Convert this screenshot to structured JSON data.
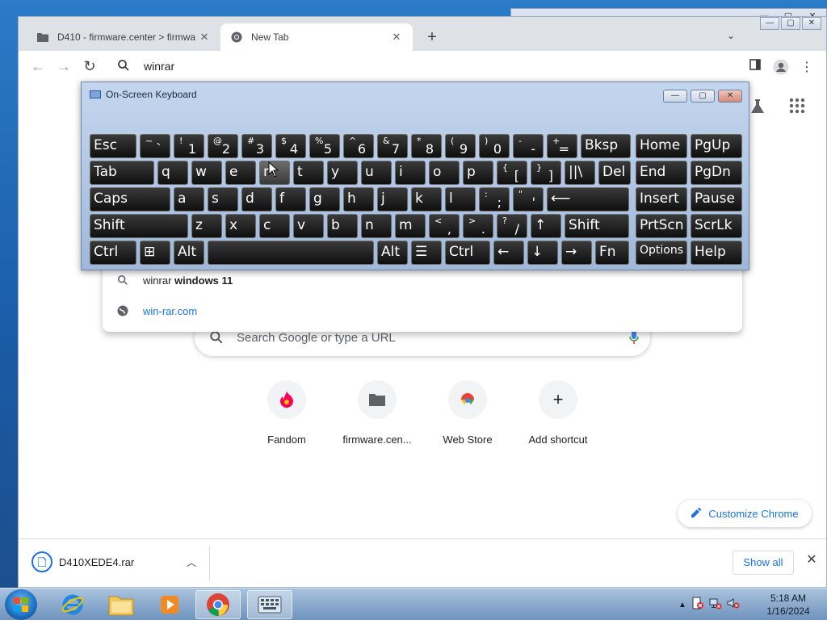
{
  "background_window": {
    "buttons": [
      "—",
      "▢",
      "✕"
    ]
  },
  "chrome": {
    "tabs": [
      {
        "label": "D410 - firmware.center > firmwa",
        "active": false
      },
      {
        "label": "New Tab",
        "active": true
      }
    ],
    "new_tab_symbol": "+",
    "window_controls": [
      "—",
      "▢",
      "✕"
    ],
    "omnibox": {
      "value": "winrar"
    },
    "suggestions": [
      {
        "type": "search",
        "prefix": "winrar",
        "bold": " windows 11"
      },
      {
        "type": "url",
        "text": "win-rar.com"
      }
    ],
    "ntp": {
      "search_placeholder": "Search Google or type a URL",
      "shortcuts": [
        {
          "label": "Fandom",
          "icon": "fandom-icon"
        },
        {
          "label": "firmware.cen...",
          "icon": "folder-icon"
        },
        {
          "label": "Web Store",
          "icon": "web-store-icon"
        },
        {
          "label": "Add shortcut",
          "icon": "plus-icon"
        }
      ],
      "customize_label": "Customize Chrome"
    },
    "downloads": {
      "file_name": "D410XEDE4.rar",
      "show_all_label": "Show all"
    }
  },
  "osk": {
    "title": "On-Screen Keyboard",
    "rows": [
      [
        "Esc",
        "~|`",
        "!|1",
        "@|2",
        "#|3",
        "$|4",
        "%|5",
        "^|6",
        "&|7",
        "*|8",
        "(|9",
        ")|0",
        "-|-",
        "+|=",
        "Bksp",
        "Home",
        "PgUp"
      ],
      [
        "Tab",
        "q",
        "w",
        "e",
        "r",
        "t",
        "y",
        "u",
        "i",
        "o",
        "p",
        "{|[",
        "}|]",
        "||\\",
        "Del",
        "End",
        "PgDn"
      ],
      [
        "Caps",
        "a",
        "s",
        "d",
        "f",
        "g",
        "h",
        "j",
        "k",
        "l",
        ":|;",
        "\"|'",
        "⟵",
        "Insert",
        "Pause"
      ],
      [
        "Shift",
        "z",
        "x",
        "c",
        "v",
        "b",
        "n",
        "m",
        "<|,",
        ">|.",
        "?|/",
        "↑",
        "Shift",
        "PrtScn",
        "ScrLk"
      ],
      [
        "Ctrl",
        "⊞",
        "Alt",
        "",
        "Alt",
        "☰",
        "Ctrl",
        "←",
        "↓",
        "→",
        "Fn",
        "Options",
        "Help"
      ]
    ]
  },
  "taskbar": {
    "clock_time": "5:18 AM",
    "clock_date": "1/16/2024"
  }
}
